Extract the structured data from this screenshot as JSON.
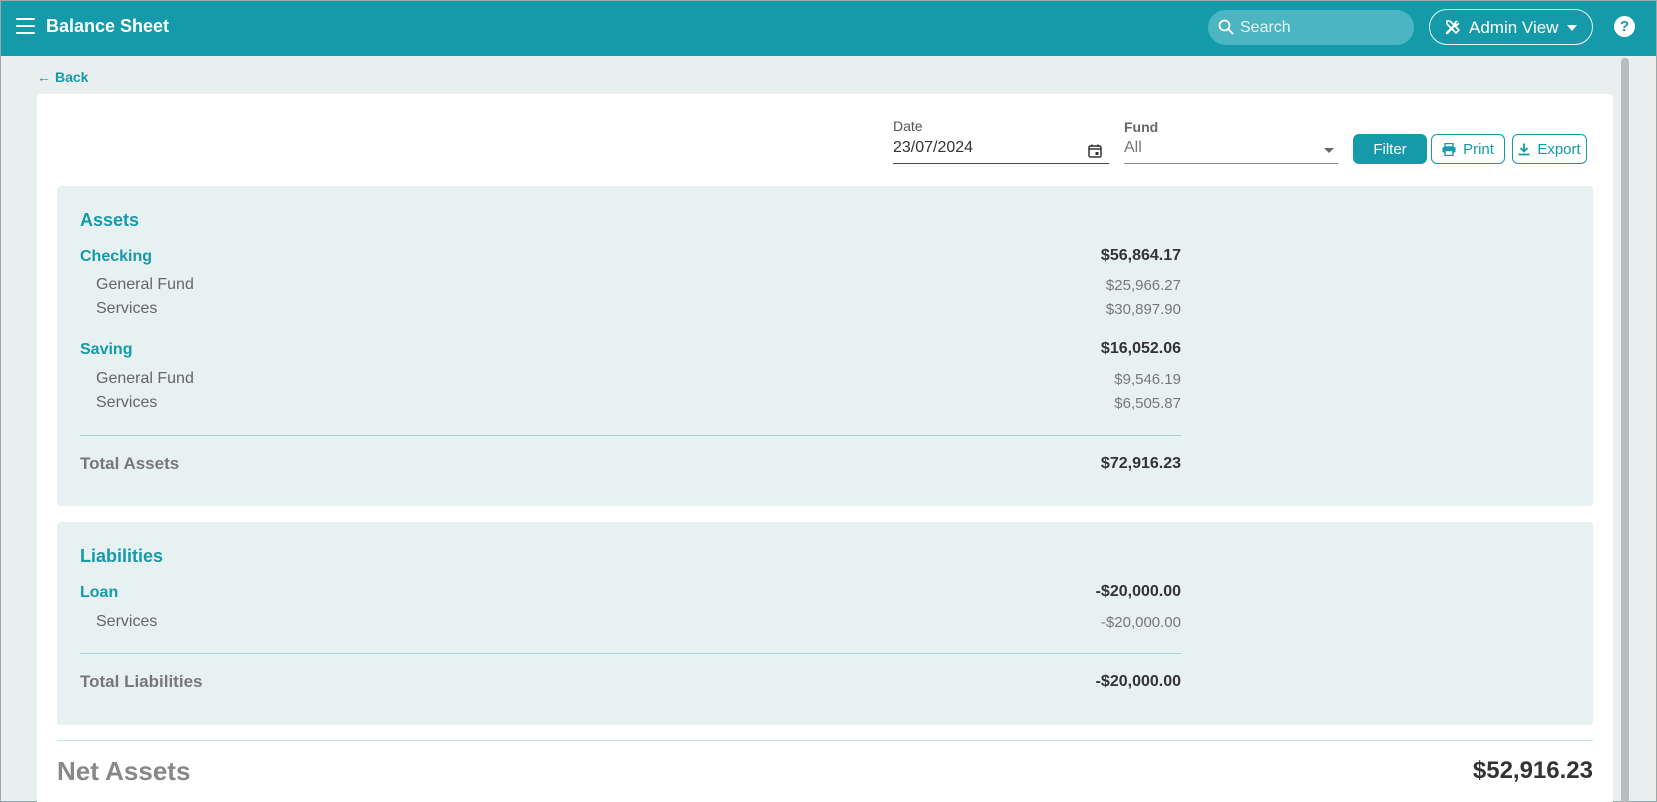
{
  "header": {
    "title": "Balance Sheet",
    "search_placeholder": "Search",
    "view_label": "Admin View",
    "help_label": "?"
  },
  "nav": {
    "back_label": "Back"
  },
  "filters": {
    "date_label": "Date",
    "date_value": "23/07/2024",
    "fund_label": "Fund",
    "fund_value": "All",
    "filter_label": "Filter",
    "print_label": "Print",
    "export_label": "Export"
  },
  "assets": {
    "title": "Assets",
    "groups": [
      {
        "name": "Checking",
        "amount": "$56,864.17",
        "items": [
          {
            "name": "General Fund",
            "amount": "$25,966.27"
          },
          {
            "name": "Services",
            "amount": "$30,897.90"
          }
        ]
      },
      {
        "name": "Saving",
        "amount": "$16,052.06",
        "items": [
          {
            "name": "General Fund",
            "amount": "$9,546.19"
          },
          {
            "name": "Services",
            "amount": "$6,505.87"
          }
        ]
      }
    ],
    "total_label": "Total Assets",
    "total_amount": "$72,916.23"
  },
  "liabilities": {
    "title": "Liabilities",
    "groups": [
      {
        "name": "Loan",
        "amount": "-$20,000.00",
        "items": [
          {
            "name": "Services",
            "amount": "-$20,000.00"
          }
        ]
      }
    ],
    "total_label": "Total Liabilities",
    "total_amount": "-$20,000.00"
  },
  "net": {
    "label": "Net Assets",
    "amount": "$52,916.23"
  },
  "colors": {
    "accent": "#149aa9",
    "panel": "#e8f1f2",
    "background": "#e9eeee"
  }
}
